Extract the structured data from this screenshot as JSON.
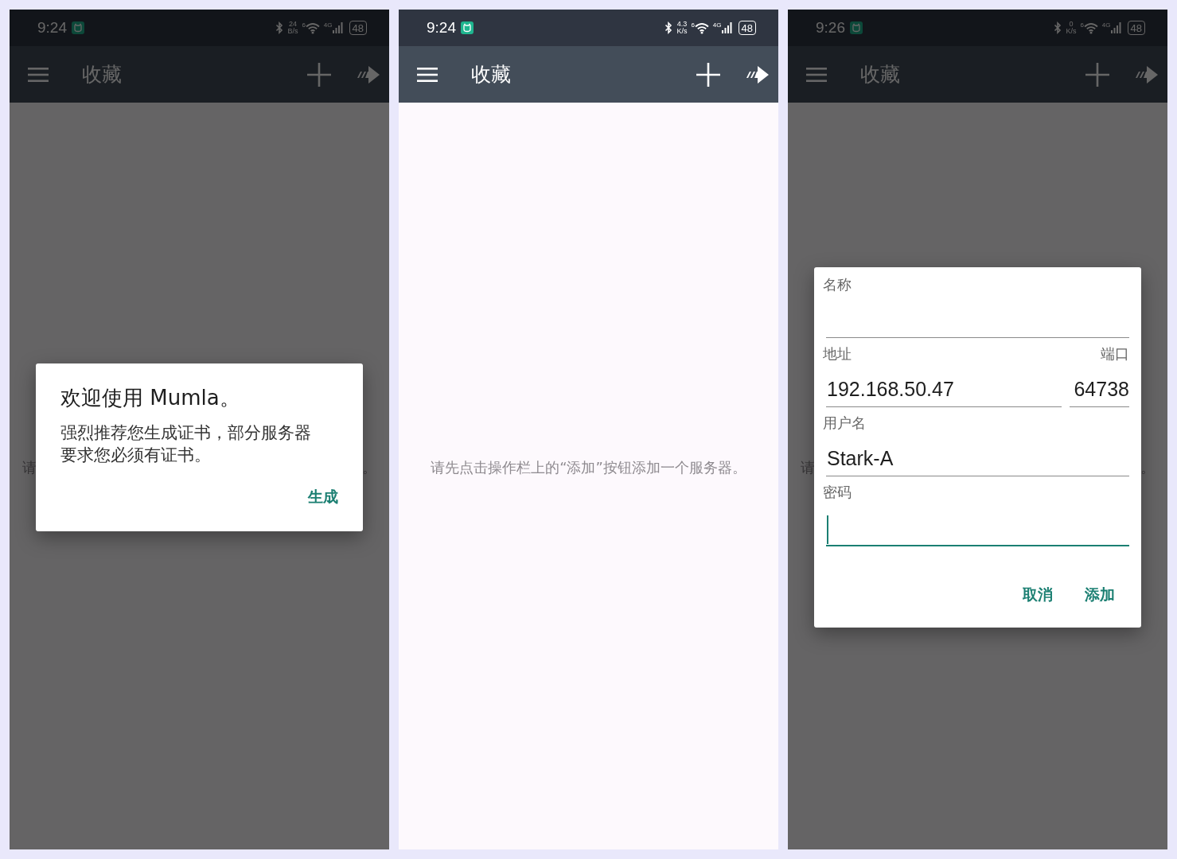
{
  "screens": [
    {
      "status_bar": {
        "time": "9:24",
        "speed": "24",
        "speed_unit": "B/s",
        "wifi_tag": "6",
        "network": "4G",
        "battery": "48"
      },
      "app_bar": {
        "title": "收藏"
      },
      "dimmed": true,
      "empty_message_parts": [
        "请",
        "。"
      ],
      "dialog": {
        "kind": "welcome",
        "title": "欢迎使用 Mumla。",
        "message": "强烈推荐您生成证书，部分服务器要求您必须有证书。",
        "buttons": [
          {
            "label": "生成"
          }
        ]
      }
    },
    {
      "status_bar": {
        "time": "9:24",
        "speed": "4.3",
        "speed_unit": "K/s",
        "wifi_tag": "6",
        "network": "4G",
        "battery": "48"
      },
      "app_bar": {
        "title": "收藏"
      },
      "dimmed": false,
      "empty_message": "请先点击操作栏上的“添加”按钮添加一个服务器。"
    },
    {
      "status_bar": {
        "time": "9:26",
        "speed": "0",
        "speed_unit": "K/s",
        "wifi_tag": "6",
        "network": "4G",
        "battery": "48"
      },
      "app_bar": {
        "title": "收藏"
      },
      "dimmed": true,
      "empty_message_parts": [
        "请",
        "。"
      ],
      "dialog": {
        "kind": "server_form",
        "rows": [
          {
            "fields": [
              {
                "label": "名称",
                "focused": false
              }
            ]
          },
          {
            "fields": [
              {
                "label": "地址",
                "value": "192.168.50.47",
                "focused": false
              },
              {
                "label": "端口",
                "value": "64738",
                "focused": false
              }
            ]
          },
          {
            "fields": [
              {
                "label": "用户名",
                "value": "Stark-A",
                "focused": false
              }
            ]
          },
          {
            "fields": [
              {
                "label": "密码",
                "focused": true
              }
            ]
          }
        ],
        "buttons": [
          {
            "label": "取消"
          },
          {
            "label": "添加"
          }
        ]
      }
    }
  ]
}
